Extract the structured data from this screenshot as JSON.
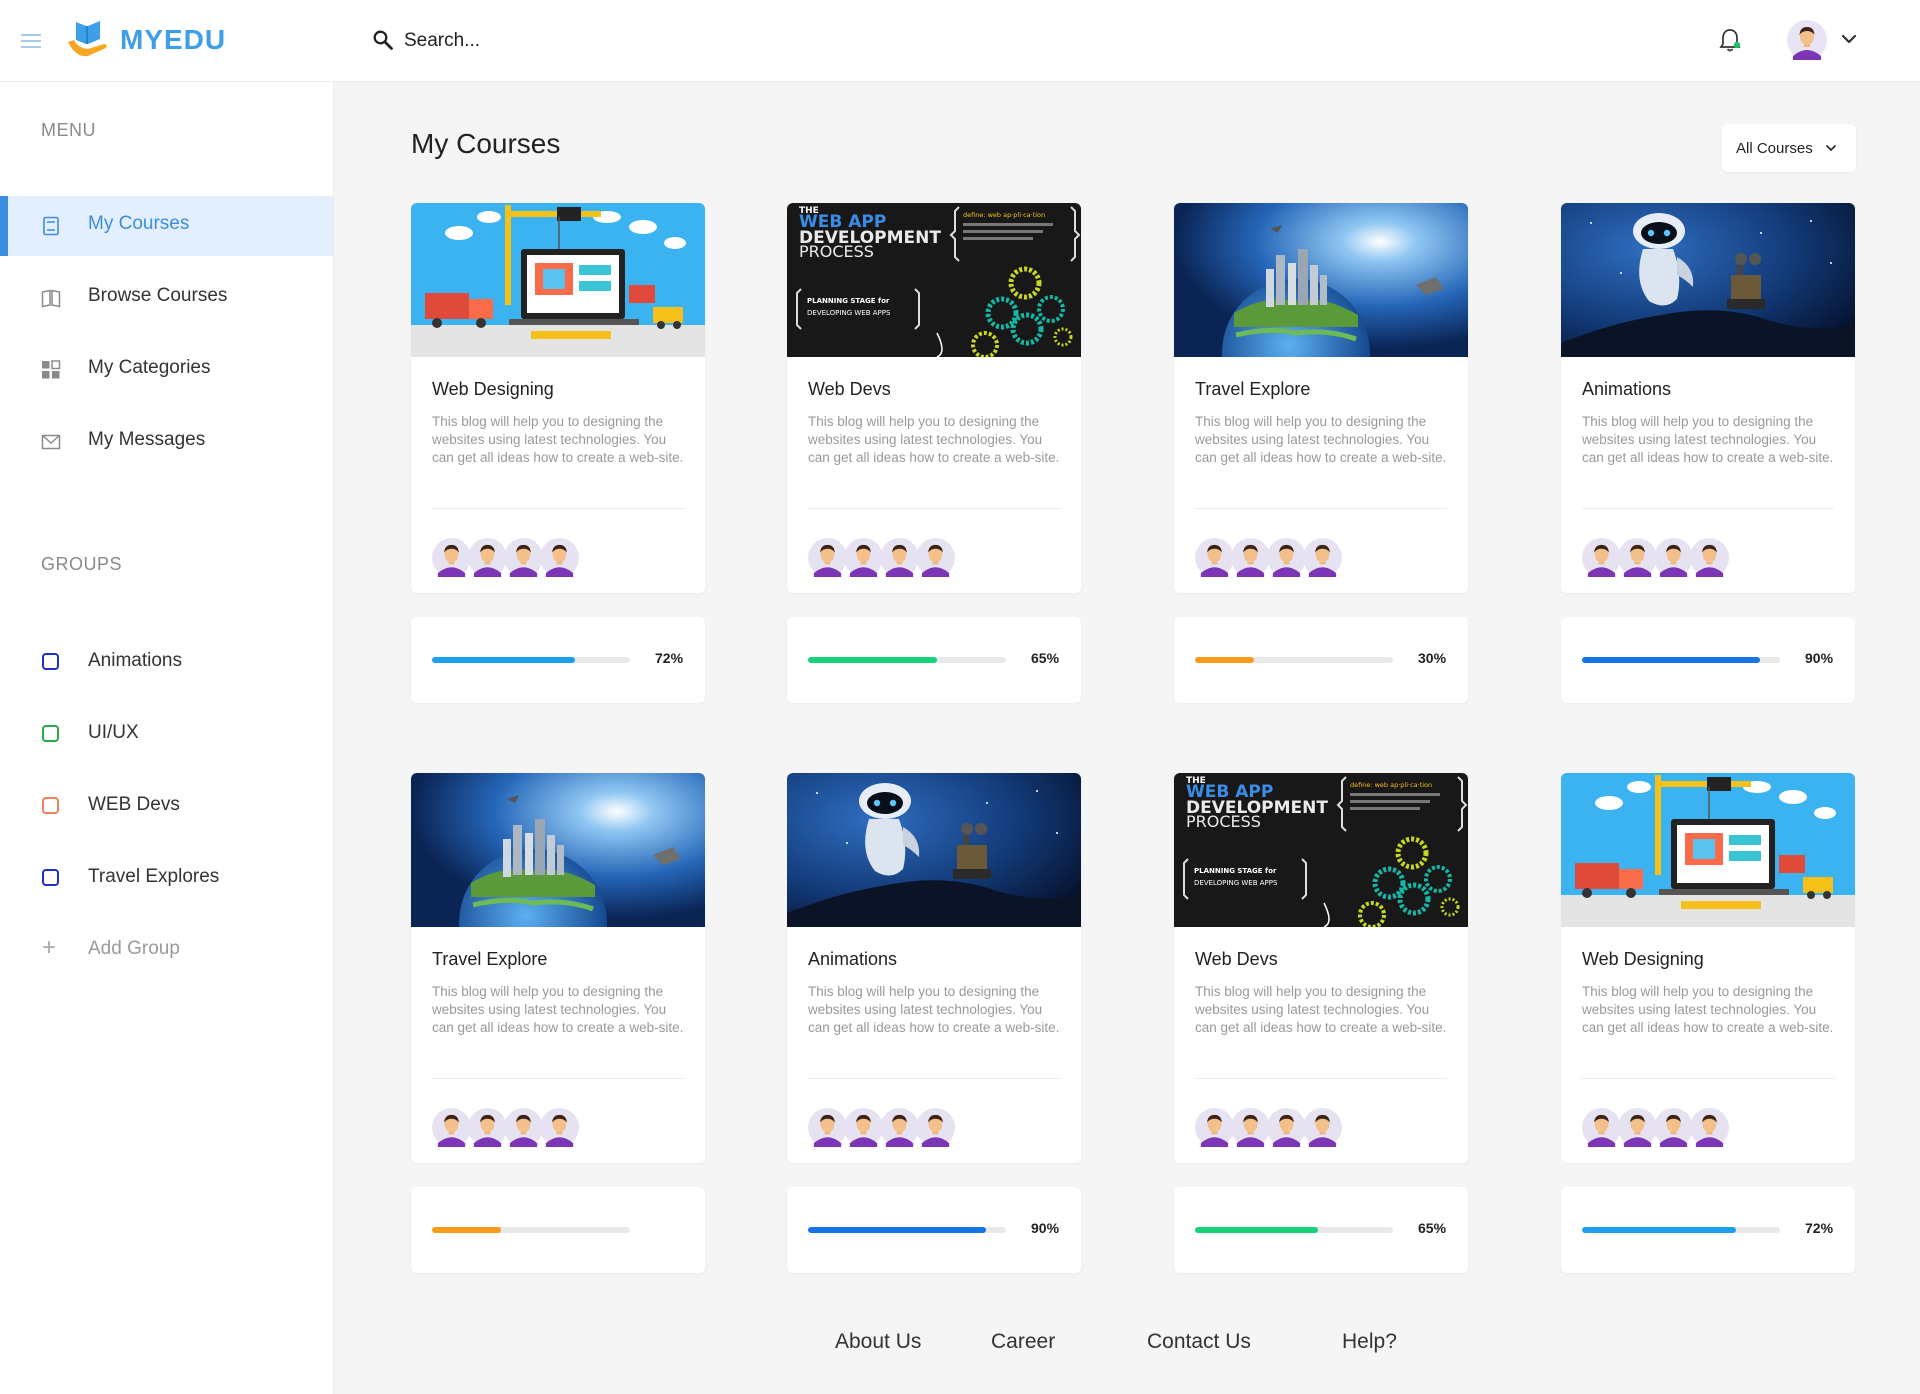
{
  "app": {
    "title": "MYEDU"
  },
  "search": {
    "placeholder": "Search..."
  },
  "sidebar": {
    "menu_title": "MENU",
    "items": [
      {
        "label": "My Courses"
      },
      {
        "label": "Browse Courses"
      },
      {
        "label": "My Categories"
      },
      {
        "label": "My Messages"
      }
    ],
    "groups_title": "GROUPS",
    "groups": [
      {
        "label": "Animations",
        "color": "#1d2fc9"
      },
      {
        "label": "UI/UX",
        "color": "#2aa84a"
      },
      {
        "label": "WEB Devs",
        "color": "#f0805a"
      },
      {
        "label": "Travel Explores",
        "color": "#1d2fc9"
      }
    ],
    "add_group": "Add Group"
  },
  "main": {
    "title": "My Courses",
    "filter": "All Courses"
  },
  "courses": [
    {
      "title": "Web Designing",
      "desc": "This blog will help you to designing the websites using latest technologies. You can get all ideas how to create a web-site.",
      "progress": 72,
      "pct_label": "72%",
      "color": "#1ca0ee",
      "thumb": "webdesign"
    },
    {
      "title": "Web Devs",
      "desc": "This blog will help you to designing the websites using latest technologies. You can get all ideas how to create a web-site.",
      "progress": 65,
      "pct_label": "65%",
      "color": "#17d17a",
      "thumb": "webapp"
    },
    {
      "title": "Travel Explore",
      "desc": "This blog will help you to designing the websites using latest technologies. You can get all ideas how to create a web-site.",
      "progress": 30,
      "pct_label": "30%",
      "color": "#f79c1b",
      "thumb": "earth"
    },
    {
      "title": "Animations",
      "desc": "This blog will help you to designing the websites using latest technologies. You can get all ideas how to create a web-site.",
      "progress": 90,
      "pct_label": "90%",
      "color": "#1674e6",
      "thumb": "robot"
    },
    {
      "title": "Travel Explore",
      "desc": "This blog will help you to designing the websites using latest technologies. You can get all ideas how to create a web-site.",
      "progress": 35,
      "pct_label": "",
      "color": "#f79c1b",
      "thumb": "earth"
    },
    {
      "title": "Animations",
      "desc": "This blog will help you to designing the websites using latest technologies. You can get all ideas how to create a web-site.",
      "progress": 90,
      "pct_label": "90%",
      "color": "#1674e6",
      "thumb": "robot"
    },
    {
      "title": "Web Devs",
      "desc": "This blog will help you to designing the websites using latest technologies. You can get all ideas how to create a web-site.",
      "progress": 62,
      "pct_label": "65%",
      "color": "#17d17a",
      "thumb": "webapp"
    },
    {
      "title": "Web Designing",
      "desc": "This blog will help you to designing the websites using latest technologies. You can get all ideas how to create a web-site.",
      "progress": 78,
      "pct_label": "72%",
      "color": "#1ca0ee",
      "thumb": "webdesign"
    }
  ],
  "thumb_text": {
    "the": "THE",
    "web_app": "WEB APP",
    "development": "DEVELOPMENT",
    "process": "PROCESS",
    "define": "define: web ap·pli·ca·tion",
    "planning": "PLANNING STAGE for",
    "developing": "DEVELOPING WEB APPS"
  },
  "footer": {
    "links": [
      "About Us",
      "Career",
      "Contact Us",
      "Help?"
    ]
  }
}
